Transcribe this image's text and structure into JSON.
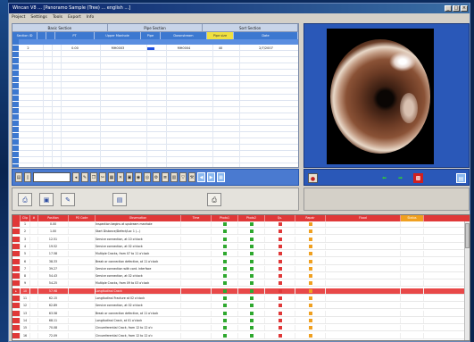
{
  "window": {
    "title": "Wincan V8 ... [Panoramo Sample (Tree) ... english ...]",
    "menu": [
      "Project",
      "Settings",
      "Tools",
      "Export",
      "Info"
    ]
  },
  "top_grid": {
    "sections": [
      "Basic Section",
      "Pipe Section",
      "Sort Section"
    ],
    "columns": [
      "Section ID",
      "",
      "",
      "PT",
      "Upper Manhole",
      "Pipe",
      "Downstream",
      "Pipe size",
      "Date"
    ],
    "row": [
      "2",
      "",
      "",
      "0.00",
      "MH0003",
      "",
      "MH0004",
      "40",
      "2/7/2007"
    ]
  },
  "bottom_table": {
    "columns": [
      "Clip",
      "#",
      "Position",
      "PO Code",
      "Observation",
      "Time",
      "Photo1",
      "Photo2",
      "Qu.",
      "Repair",
      "Flood",
      "Status"
    ],
    "rows": [
      [
        "1",
        "",
        "0.00",
        "",
        "Inspection begins at upstream manhole",
        "",
        "green",
        "green",
        "red",
        "orange",
        "",
        ""
      ],
      [
        "2",
        "",
        "1.00",
        "",
        "Start Distance/Defect/Loc 1 (...)",
        "",
        "green",
        "green",
        "red",
        "orange",
        "",
        ""
      ],
      [
        "3",
        "",
        "12.51",
        "",
        "Service connection, at 10 o'clock",
        "",
        "green",
        "green",
        "red",
        "orange",
        "",
        ""
      ],
      [
        "4",
        "",
        "19.52",
        "",
        "Service connection, at 02 o'clock",
        "",
        "green",
        "green",
        "red",
        "orange",
        "",
        ""
      ],
      [
        "5",
        "",
        "17.58",
        "",
        "Multiple Cracks, from 07 to 11 o'clock",
        "",
        "green",
        "green",
        "red",
        "orange",
        "",
        ""
      ],
      [
        "6",
        "",
        "38.33",
        "",
        "Break or connection defective, at 11 o'clock",
        "",
        "green",
        "green",
        "red",
        "orange",
        "",
        ""
      ],
      [
        "7",
        "",
        "39.27",
        "",
        "Service connection with cont. interface",
        "",
        "green",
        "green",
        "red",
        "orange",
        "",
        ""
      ],
      [
        "8",
        "",
        "54.43",
        "",
        "Service connection, at 02 o'clock",
        "",
        "green",
        "green",
        "red",
        "orange",
        "",
        ""
      ],
      [
        "9",
        "",
        "54.25",
        "",
        "Multiple Cracks, from 09 to 03 o'clock",
        "",
        "green",
        "green",
        "red",
        "orange",
        "",
        ""
      ],
      [
        "10",
        "",
        "57.98",
        "",
        "Longitudinal Crack",
        "",
        "green",
        "green",
        "red",
        "orange",
        "",
        ""
      ],
      [
        "11",
        "",
        "62.15",
        "",
        "Longitudinal Fracture at 02 o'clock",
        "",
        "green",
        "green",
        "red",
        "orange",
        "",
        ""
      ],
      [
        "12",
        "",
        "62.89",
        "",
        "Service connection, at 02 o'clock",
        "",
        "green",
        "green",
        "red",
        "orange",
        "",
        ""
      ],
      [
        "13",
        "",
        "63.58",
        "",
        "Break or connection defective, at 11 o'clock",
        "",
        "green",
        "green",
        "red",
        "orange",
        "",
        ""
      ],
      [
        "14",
        "",
        "68.11",
        "",
        "Longitudinal Crack, at 01 o'clock",
        "",
        "green",
        "green",
        "red",
        "orange",
        "",
        ""
      ],
      [
        "15",
        "",
        "70.08",
        "",
        "Circumferential Crack, from 12 to 12 o'c",
        "",
        "green",
        "green",
        "red",
        "orange",
        "",
        ""
      ],
      [
        "16",
        "",
        "72.09",
        "",
        "Circumferential Crack, from 12 to 12 o'c",
        "",
        "green",
        "green",
        "red",
        "orange",
        "",
        ""
      ]
    ],
    "selected_index": 9
  },
  "colors": {
    "accent": "#3c78d0",
    "danger": "#e03838",
    "ok": "#2ea82e",
    "warn": "#f0a020"
  }
}
